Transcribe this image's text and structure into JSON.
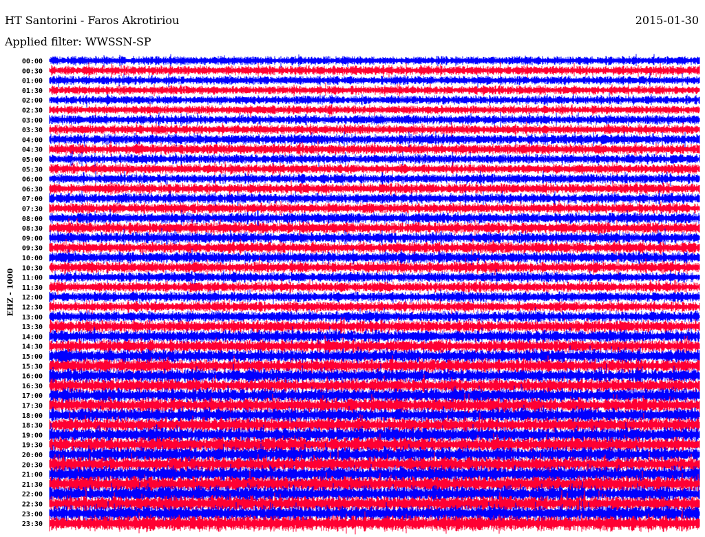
{
  "header": {
    "station": "HT Santorini - Faros Akrotiriou",
    "date": "2015-01-30",
    "filter": "Applied filter: WWSSN-SP"
  },
  "chart_data": {
    "type": "line",
    "title": "HT Santorini - Faros Akrotiriou",
    "ylabel": "EHZ - 1000",
    "row_labels": [
      "00:00",
      "00:30",
      "01:00",
      "01:30",
      "02:00",
      "02:30",
      "03:00",
      "03:30",
      "04:00",
      "04:30",
      "05:00",
      "05:30",
      "06:00",
      "06:30",
      "07:00",
      "07:30",
      "08:00",
      "08:30",
      "09:00",
      "09:30",
      "10:00",
      "10:30",
      "11:00",
      "11:30",
      "12:00",
      "12:30",
      "13:00",
      "13:30",
      "14:00",
      "14:30",
      "15:00",
      "15:30",
      "16:00",
      "16:30",
      "17:00",
      "17:30",
      "18:00",
      "18:30",
      "19:00",
      "19:30",
      "20:00",
      "20:30",
      "21:00",
      "21:30",
      "22:00",
      "22:30",
      "23:00",
      "23:30"
    ],
    "row_minutes": 30,
    "series_colors": [
      "#0000ff",
      "#ff0033"
    ],
    "relative_noise_amplitude": [
      0.55,
      0.6,
      0.55,
      0.55,
      0.55,
      0.55,
      0.6,
      0.6,
      0.65,
      0.65,
      0.6,
      0.6,
      0.6,
      0.65,
      0.65,
      0.65,
      0.7,
      0.7,
      0.7,
      0.7,
      0.7,
      0.7,
      0.65,
      0.65,
      0.65,
      0.65,
      0.7,
      0.75,
      0.8,
      0.8,
      0.85,
      0.85,
      0.85,
      0.85,
      0.9,
      0.9,
      0.9,
      0.9,
      0.95,
      0.95,
      0.95,
      0.95,
      1.0,
      1.0,
      1.0,
      1.0,
      1.0,
      1.0
    ]
  }
}
